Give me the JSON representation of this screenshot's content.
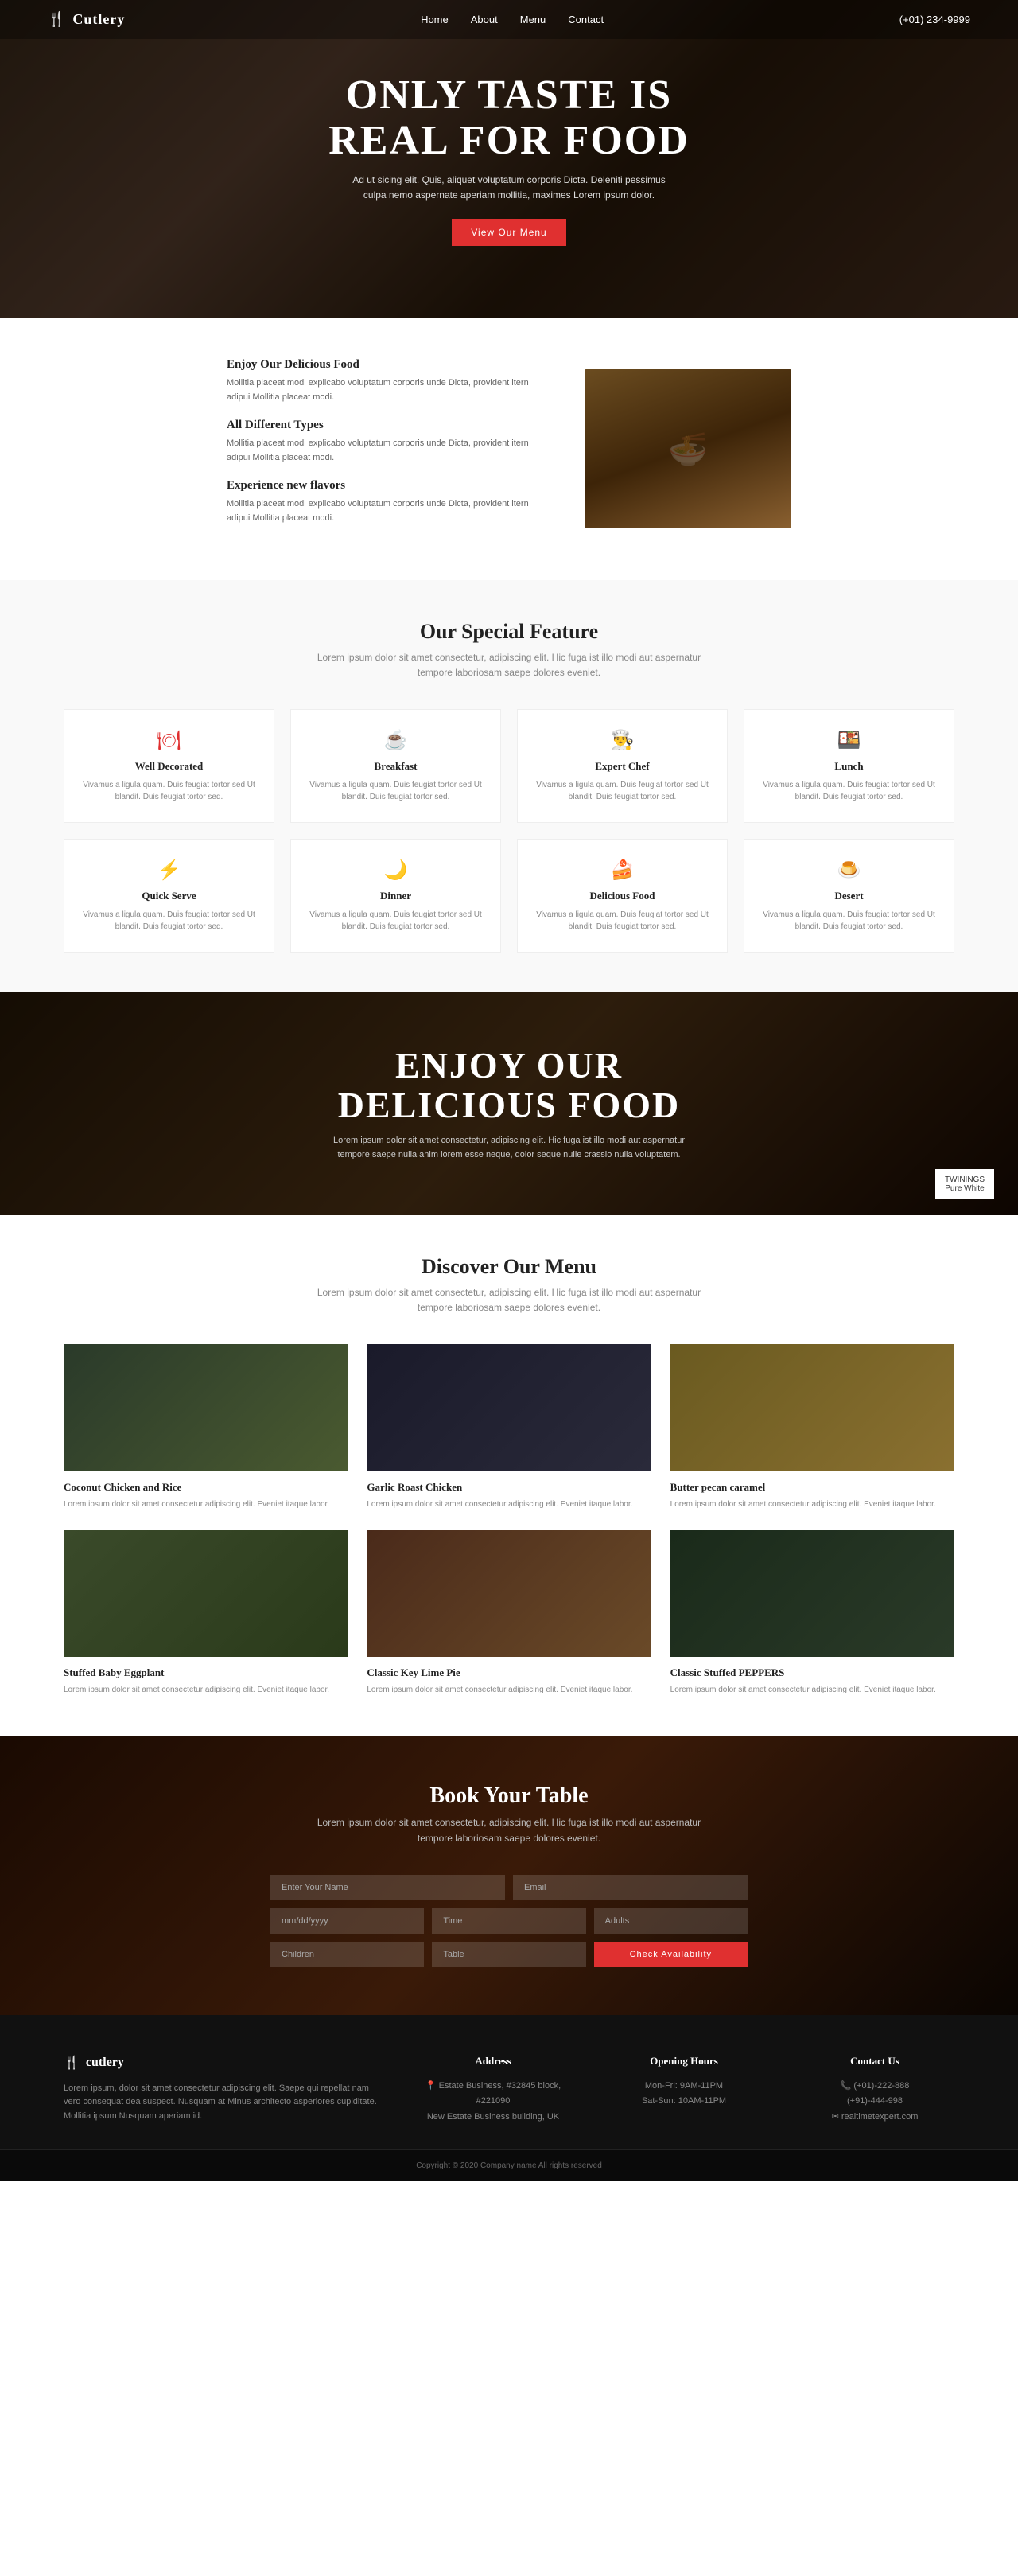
{
  "nav": {
    "logo_icon": "🍴",
    "logo_text": "Cutlery",
    "links": [
      "Home",
      "About",
      "Menu",
      "Contact"
    ],
    "phone": "(+01) 234-9999"
  },
  "hero": {
    "headline_line1": "ONLY TASTE IS",
    "headline_line2": "REAL FOR FOOD",
    "description": "Ad ut sicing elit. Quis, aliquet voluptatum corporis Dicta. Deleniti pessimus culpa nemo aspernate aperiam mollitia, maximes Lorem ipsum dolor.",
    "cta_label": "View Our Menu"
  },
  "about": {
    "block1_title": "Enjoy Our Delicious Food",
    "block1_text": "Mollitia placeat modi explicabo voluptatum corporis unde Dicta, provident itern adipui Mollitia placeat modi.",
    "block2_title": "All Different Types",
    "block2_text": "Mollitia placeat modi explicabo voluptatum corporis unde Dicta, provident itern adipui Mollitia placeat modi.",
    "block3_title": "Experience new flavors",
    "block3_text": "Mollitia placeat modi explicabo voluptatum corporis unde Dicta, provident itern adipui Mollitia placeat modi."
  },
  "features": {
    "section_title": "Our Special Feature",
    "section_subtitle": "Lorem ipsum dolor sit amet consectetur, adipiscing elit. Hic fuga ist illo modi aut aspernatur tempore laboriosam saepe dolores eveniet.",
    "items": [
      {
        "icon": "🍽",
        "title": "Well Decorated",
        "text": "Vivamus a ligula quam. Duis feugiat tortor sed Ut blandit. Duis feugiat tortor sed."
      },
      {
        "icon": "☕",
        "title": "Breakfast",
        "text": "Vivamus a ligula quam. Duis feugiat tortor sed Ut blandit. Duis feugiat tortor sed."
      },
      {
        "icon": "👨‍🍳",
        "title": "Expert Chef",
        "text": "Vivamus a ligula quam. Duis feugiat tortor sed Ut blandit. Duis feugiat tortor sed."
      },
      {
        "icon": "🍱",
        "title": "Lunch",
        "text": "Vivamus a ligula quam. Duis feugiat tortor sed Ut blandit. Duis feugiat tortor sed."
      },
      {
        "icon": "⚡",
        "title": "Quick Serve",
        "text": "Vivamus a ligula quam. Duis feugiat tortor sed Ut blandit. Duis feugiat tortor sed."
      },
      {
        "icon": "🌙",
        "title": "Dinner",
        "text": "Vivamus a ligula quam. Duis feugiat tortor sed Ut blandit. Duis feugiat tortor sed."
      },
      {
        "icon": "🍰",
        "title": "Delicious Food",
        "text": "Vivamus a ligula quam. Duis feugiat tortor sed Ut blandit. Duis feugiat tortor sed."
      },
      {
        "icon": "🍮",
        "title": "Desert",
        "text": "Vivamus a ligula quam. Duis feugiat tortor sed Ut blandit. Duis feugiat tortor sed."
      }
    ]
  },
  "banner": {
    "headline_line1": "ENJOY OUR",
    "headline_line2": "DELICIOUS FOOD",
    "text": "Lorem ipsum dolor sit amet consectetur, adipiscing elit. Hic fuga ist illo modi aut aspernatur tempore saepe nulla anim lorem esse neque, dolor seque nulle crassio nulla voluptatem.",
    "corner_brand": "TWININGS",
    "corner_sub": "Pure White"
  },
  "menu": {
    "section_title": "Discover Our Menu",
    "section_subtitle": "Lorem ipsum dolor sit amet consectetur, adipiscing elit. Hic fuga ist illo modi aut aspernatur tempore laboriosam saepe dolores eveniet.",
    "items": [
      {
        "title": "Coconut Chicken and Rice",
        "desc": "Lorem ipsum dolor sit amet consectetur adipiscing elit. Eveniet itaque labor."
      },
      {
        "title": "Garlic Roast Chicken",
        "desc": "Lorem ipsum dolor sit amet consectetur adipiscing elit. Eveniet itaque labor."
      },
      {
        "title": "Butter pecan caramel",
        "desc": "Lorem ipsum dolor sit amet consectetur adipiscing elit. Eveniet itaque labor."
      },
      {
        "title": "Stuffed Baby Eggplant",
        "desc": "Lorem ipsum dolor sit amet consectetur adipiscing elit. Eveniet itaque labor."
      },
      {
        "title": "Classic Key Lime Pie",
        "desc": "Lorem ipsum dolor sit amet consectetur adipiscing elit. Eveniet itaque labor."
      },
      {
        "title": "Classic Stuffed PEPPERS",
        "desc": "Lorem ipsum dolor sit amet consectetur adipiscing elit. Eveniet itaque labor."
      }
    ]
  },
  "booking": {
    "section_title": "Book Your Table",
    "section_subtitle": "Lorem ipsum dolor sit amet consectetur, adipiscing elit. Hic fuga ist illo modi aut aspernatur tempore laboriosam saepe dolores eveniet.",
    "fields": {
      "name_placeholder": "Enter Your Name",
      "email_placeholder": "Email",
      "date_placeholder": "mm/dd/yyyy",
      "time_placeholder": "Time",
      "adults_placeholder": "Adults",
      "children_placeholder": "Children",
      "table_placeholder": "Table"
    },
    "cta_label": "Check Availability"
  },
  "footer": {
    "logo_icon": "🍴",
    "logo_text": "cutlery",
    "brand_desc": "Lorem ipsum, dolor sit amet consectetur adipiscing elit. Saepe qui repellat nam vero consequat dea suspect. Nusquam at Minus architecto asperiores cupiditate. Mollitia ipsum Nusquam aperiam id.",
    "address_title": "Address",
    "address_icon": "📍",
    "address_line1": "Estate Business, #32845 block, #221090",
    "address_line2": "New Estate Business building, UK",
    "hours_title": "Opening Hours",
    "hours_line1": "Mon-Fri: 9AM-11PM",
    "hours_line2": "Sat-Sun: 10AM-11PM",
    "contact_title": "Contact Us",
    "contact_phone_icon": "📞",
    "contact_phone1": "(+01)-222-888",
    "contact_phone2": "(+91)-444-998",
    "contact_email_icon": "✉",
    "contact_email": "realtimetexpert.com",
    "copyright": "Copyright © 2020 Company name All rights reserved"
  }
}
